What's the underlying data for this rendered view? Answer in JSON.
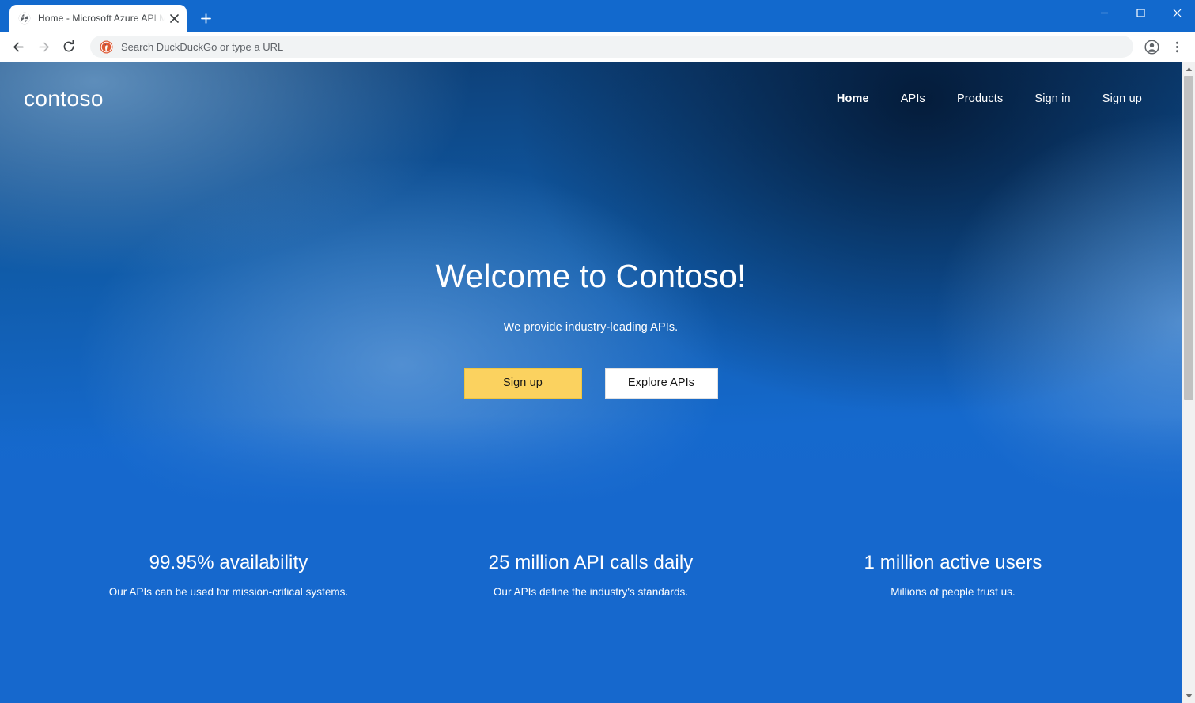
{
  "browser": {
    "tab": {
      "title": "Home - Microsoft Azure API Man",
      "favicon": "globe-icon",
      "close": "✕"
    },
    "new_tab_label": "+",
    "window_controls": {
      "minimize": "—",
      "maximize": "☐",
      "close": "✕"
    },
    "toolbar": {
      "back": "←",
      "forward": "→",
      "reload": "↻",
      "omnibox_placeholder": "Search DuckDuckGo or type a URL",
      "omnibox_value": "",
      "search_engine_icon": "duckduckgo-icon",
      "profile_icon": "account-avatar-icon",
      "menu_icon": "three-dot-menu-icon"
    },
    "scrollbar": {
      "up_arrow": "▲",
      "down_arrow": "▼"
    }
  },
  "site": {
    "logo": "contoso",
    "nav": [
      {
        "label": "Home",
        "active": true
      },
      {
        "label": "APIs",
        "active": false
      },
      {
        "label": "Products",
        "active": false
      },
      {
        "label": "Sign in",
        "active": false
      },
      {
        "label": "Sign up",
        "active": false
      }
    ],
    "hero": {
      "title": "Welcome to Contoso!",
      "subtitle": "We provide industry-leading APIs.",
      "primary_button": "Sign up",
      "secondary_button": "Explore APIs"
    },
    "stats": [
      {
        "value": "99.95% availability",
        "description": "Our APIs can be used for mission-critical systems."
      },
      {
        "value": "25 million API calls daily",
        "description": "Our APIs define the industry's standards."
      },
      {
        "value": "1 million active users",
        "description": "Millions of people trust us."
      }
    ],
    "colors": {
      "brand_blue": "#1668cd",
      "dark_navy": "#031630",
      "accent_yellow": "#fbd25f",
      "white": "#ffffff"
    }
  }
}
